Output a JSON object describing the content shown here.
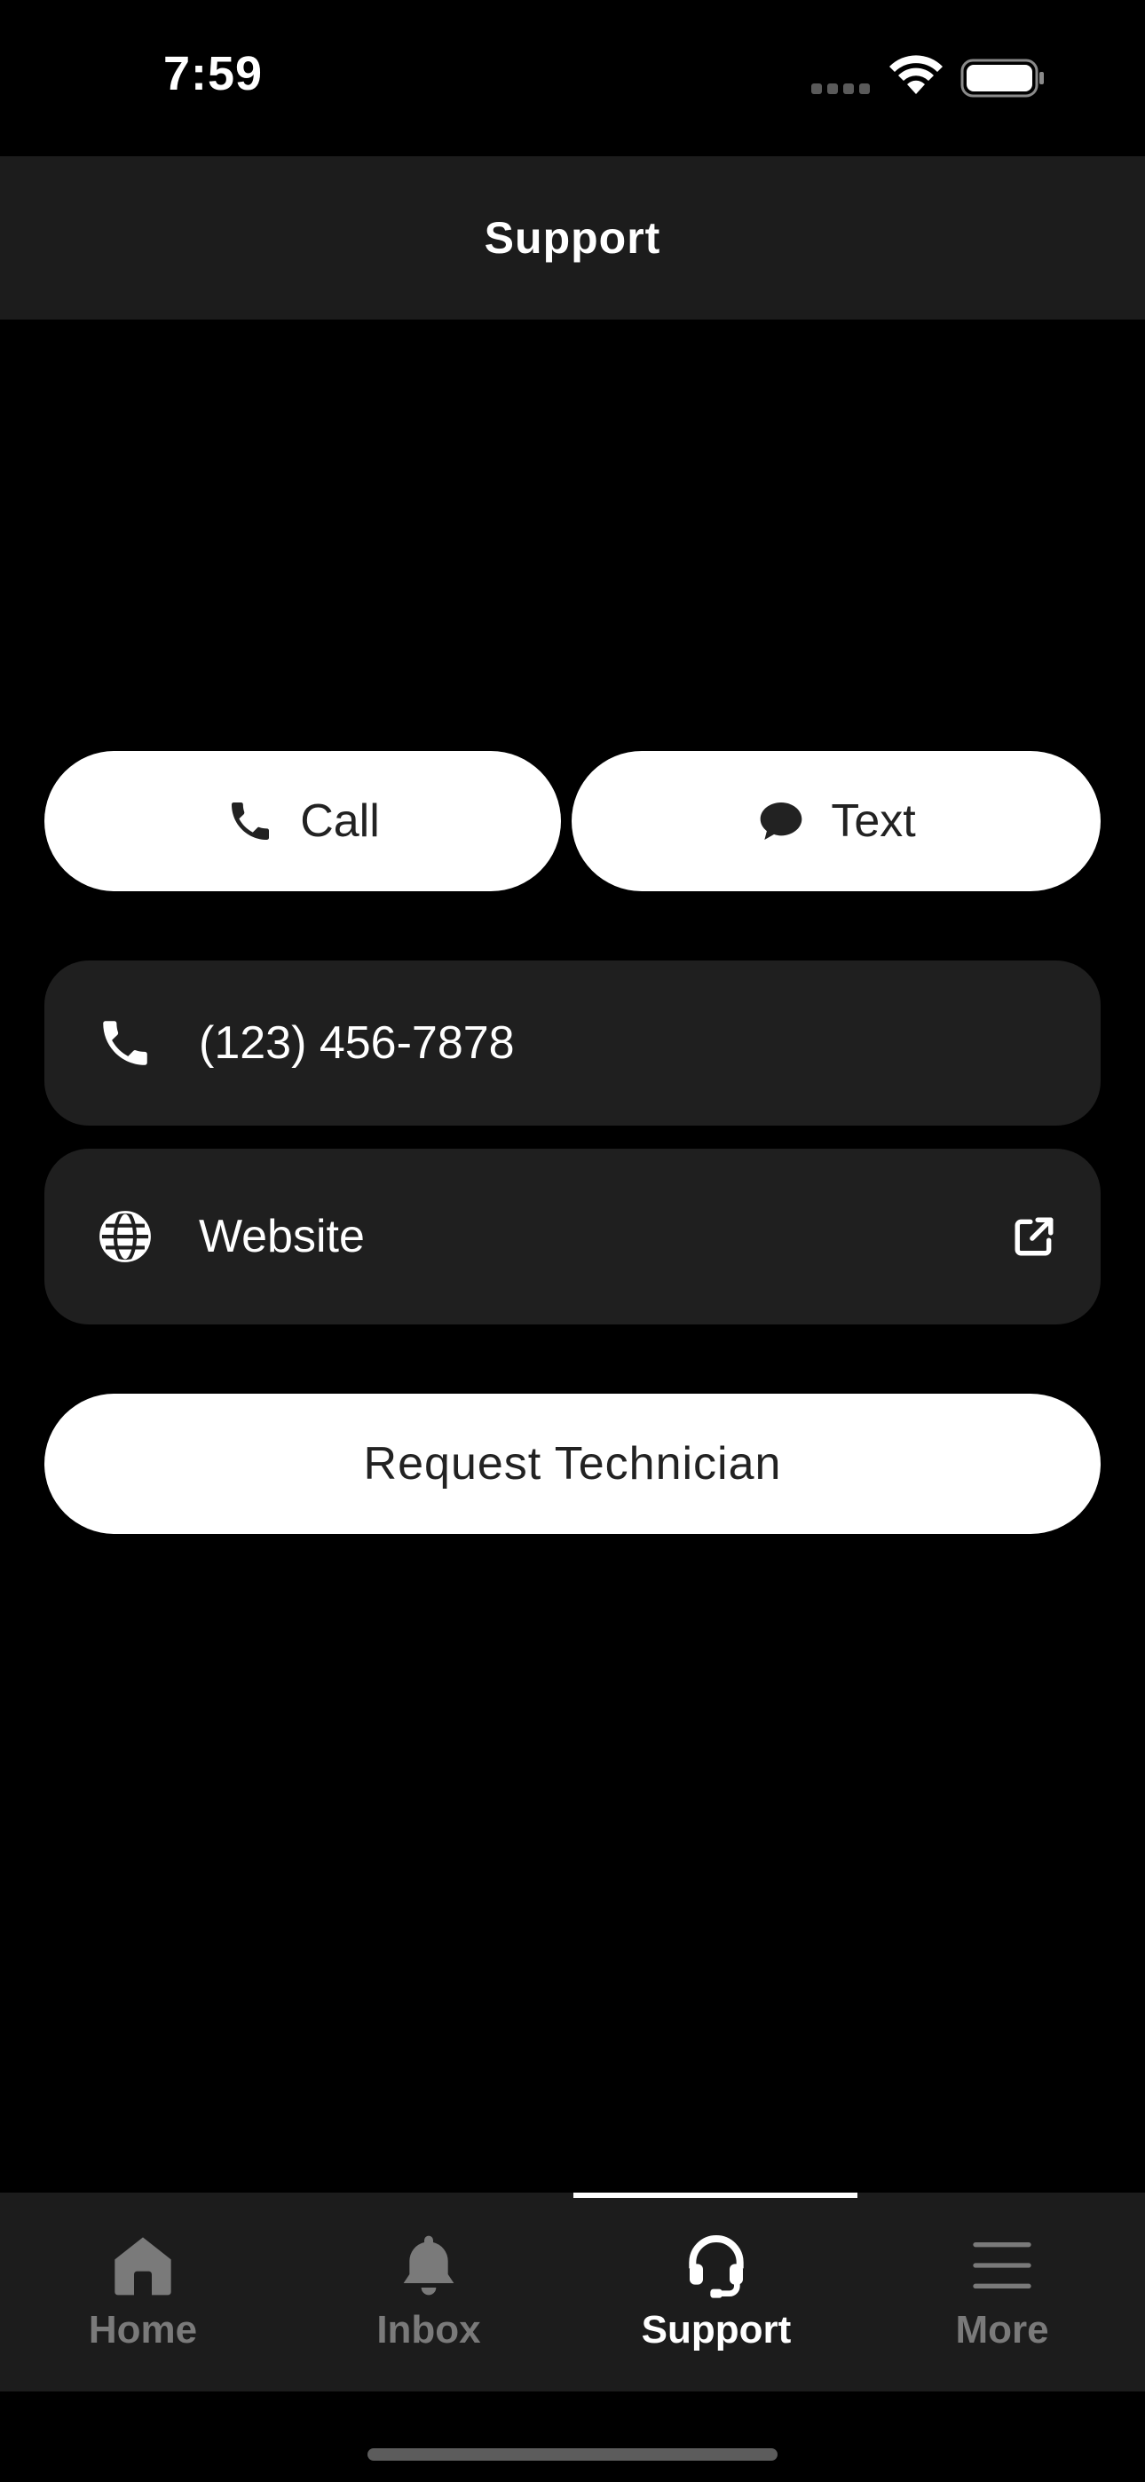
{
  "status_bar": {
    "time": "7:59"
  },
  "header": {
    "title": "Support"
  },
  "actions": {
    "call_label": "Call",
    "text_label": "Text"
  },
  "contact": {
    "phone": "(123) 456-7878",
    "website_label": "Website"
  },
  "request_button": {
    "label": "Request Technician"
  },
  "tab_bar": {
    "active": "Support",
    "tabs": [
      {
        "label": "Home",
        "icon": "home-icon"
      },
      {
        "label": "Inbox",
        "icon": "bell-icon"
      },
      {
        "label": "Support",
        "icon": "headset-icon"
      },
      {
        "label": "More",
        "icon": "menu-icon"
      }
    ]
  },
  "colors": {
    "background": "#000000",
    "surface": "#1f1f1f",
    "header": "#1c1c1c",
    "button": "#ffffff",
    "button_text": "#222222",
    "inactive_tab": "#7a7a7a"
  }
}
